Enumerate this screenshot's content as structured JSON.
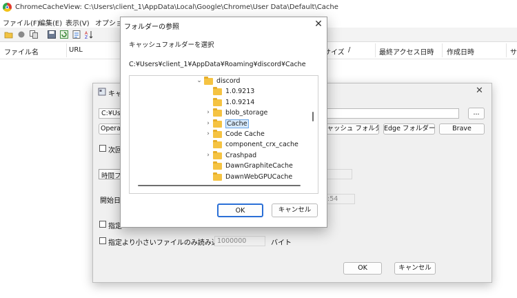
{
  "app": {
    "title": "ChromeCacheView:  C:\\Users\\client_1\\AppData\\Local\\Google\\Chrome\\User Data\\Default\\Cache"
  },
  "menu": [
    "ファイル(F)",
    "編集(E)",
    "表示(V)",
    "オプション"
  ],
  "columns": [
    "ファイル名",
    "URL",
    "サイズ",
    "/",
    "最終アクセス日時",
    "作成日時",
    "サ"
  ],
  "options_dialog": {
    "title": "キャ",
    "path_value": "C:¥User",
    "opera_button": "Opera キ",
    "chrome_cache_button": "e キャッシュ フォルダ",
    "edge_button": "Edge フォルダー",
    "brave_button": "Brave",
    "browse_button": "...",
    "next_label": "次回",
    "time_filter": "時間フィ",
    "start_date_label": "開始日",
    "time_value": ":54",
    "limit_label": "指定",
    "smaller_files_label": "指定より小さいファイルのみ読み込み...",
    "smaller_files_value": "1000000",
    "bytes_unit": "バイト",
    "ok": "OK",
    "cancel": "キャンセル"
  },
  "folder_dialog": {
    "title": "フォルダーの参照",
    "instruction": "キャッシュフォルダーを選択",
    "path": "C:¥Users¥client_1¥AppData¥Roaming¥discord¥Cache",
    "tree": [
      {
        "label": "discord",
        "arrow": "open",
        "indent": 0
      },
      {
        "label": "1.0.9213",
        "arrow": "none",
        "indent": 1
      },
      {
        "label": "1.0.9214",
        "arrow": "none",
        "indent": 1
      },
      {
        "label": "blob_storage",
        "arrow": "closed",
        "indent": 1
      },
      {
        "label": "Cache",
        "arrow": "closed",
        "indent": 1,
        "selected": true
      },
      {
        "label": "Code Cache",
        "arrow": "closed",
        "indent": 1
      },
      {
        "label": "component_crx_cache",
        "arrow": "none",
        "indent": 1
      },
      {
        "label": "Crashpad",
        "arrow": "closed",
        "indent": 1
      },
      {
        "label": "DawnGraphiteCache",
        "arrow": "none",
        "indent": 1
      },
      {
        "label": "DawnWebGPUCache",
        "arrow": "none",
        "indent": 1
      }
    ],
    "ok": "OK",
    "cancel": "キャンセル"
  }
}
